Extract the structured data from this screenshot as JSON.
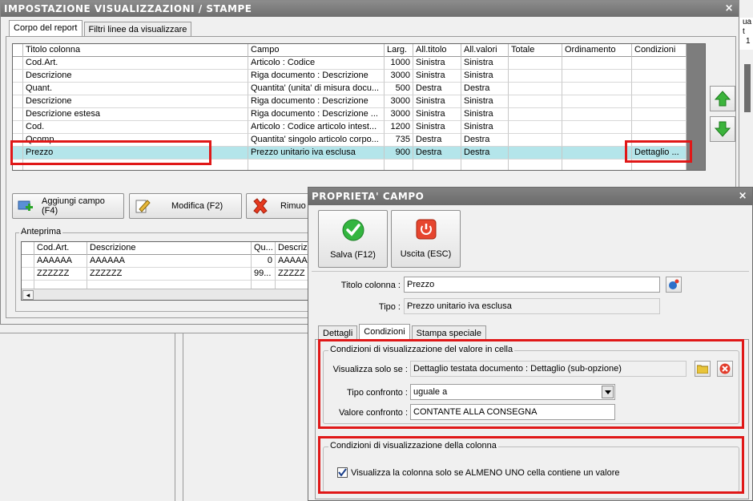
{
  "main": {
    "title": "IMPOSTAZIONE VISUALIZZAZIONI / STAMPE",
    "close_glyph": "×",
    "tabs": [
      "Corpo del report",
      "Filtri linee da visualizzare"
    ],
    "columns": [
      "Titolo colonna",
      "Campo",
      "Larg.",
      "All.titolo",
      "All.valori",
      "Totale",
      "Ordinamento",
      "Condizioni"
    ],
    "rows": [
      {
        "titolo": "Cod.Art.",
        "campo": "Articolo : Codice",
        "larg": "1000",
        "all_titolo": "Sinistra",
        "all_valori": "Sinistra",
        "totale": "",
        "ordinamento": "",
        "condizioni": ""
      },
      {
        "titolo": "Descrizione",
        "campo": "Riga documento : Descrizione",
        "larg": "3000",
        "all_titolo": "Sinistra",
        "all_valori": "Sinistra",
        "totale": "",
        "ordinamento": "",
        "condizioni": ""
      },
      {
        "titolo": "Quant.",
        "campo": "Quantita' (unita' di misura docu...",
        "larg": "500",
        "all_titolo": "Destra",
        "all_valori": "Destra",
        "totale": "",
        "ordinamento": "",
        "condizioni": ""
      },
      {
        "titolo": "Descrizione",
        "campo": "Riga documento : Descrizione",
        "larg": "3000",
        "all_titolo": "Sinistra",
        "all_valori": "Sinistra",
        "totale": "",
        "ordinamento": "",
        "condizioni": ""
      },
      {
        "titolo": "Descrizione estesa",
        "campo": "Riga documento : Descrizione ...",
        "larg": "3000",
        "all_titolo": "Sinistra",
        "all_valori": "Sinistra",
        "totale": "",
        "ordinamento": "",
        "condizioni": ""
      },
      {
        "titolo": "Cod.",
        "campo": "Articolo : Codice articolo intest...",
        "larg": "1200",
        "all_titolo": "Sinistra",
        "all_valori": "Sinistra",
        "totale": "",
        "ordinamento": "",
        "condizioni": ""
      },
      {
        "titolo": "Qcomp",
        "campo": "Quantita' singolo articolo corpo...",
        "larg": "735",
        "all_titolo": "Destra",
        "all_valori": "Destra",
        "totale": "",
        "ordinamento": "",
        "condizioni": ""
      },
      {
        "titolo": "Prezzo",
        "campo": "Prezzo unitario iva esclusa",
        "larg": "900",
        "all_titolo": "Destra",
        "all_valori": "Destra",
        "totale": "",
        "ordinamento": "",
        "condizioni": "Dettaglio ..."
      }
    ],
    "buttons": {
      "add": "Aggiungi campo (F4)",
      "edit": "Modifica (F2)",
      "remove": "Rimuo"
    },
    "preview": {
      "legend": "Anteprima",
      "columns": [
        "Cod.Art.",
        "Descrizione",
        "Qu...",
        "Descriz"
      ],
      "rows": [
        [
          "AAAAAA",
          "AAAAAA",
          "0",
          "AAAAA"
        ],
        [
          "ZZZZZZ",
          "ZZZZZZ",
          "99...",
          "ZZZZZ"
        ]
      ],
      "scroll_left": "◂"
    }
  },
  "bg_window": {
    "fragment_lines": [
      "ua",
      "t",
      "1"
    ]
  },
  "dialog": {
    "title": "PROPRIETA' CAMPO",
    "close_glyph": "×",
    "save_label": "Salva (F12)",
    "exit_label": "Uscita (ESC)",
    "titolo_label": "Titolo colonna :",
    "titolo_value": "Prezzo",
    "tipo_label": "Tipo :",
    "tipo_value": "Prezzo unitario iva esclusa",
    "tabs": [
      "Dettagli",
      "Condizioni",
      "Stampa speciale"
    ],
    "cond_value_legend": "Condizioni di visualizzazione del valore in cella",
    "visualizza_label": "Visualizza solo se :",
    "visualizza_value": "Dettaglio testata documento : Dettaglio (sub-opzione)",
    "tipo_confronto_label": "Tipo confronto :",
    "tipo_confronto_value": "uguale a",
    "valore_confronto_label": "Valore confronto :",
    "valore_confronto_value": "CONTANTE ALLA CONSEGNA",
    "cond_col_legend": "Condizioni di visualizzazione della colonna",
    "checkbox_label": "Visualizza la colonna solo se ALMENO UNO cella contiene un valore",
    "checkbox_checked": true
  },
  "icons": [
    "add-field-icon",
    "edit-icon",
    "remove-icon",
    "arrow-up-icon",
    "arrow-down-icon",
    "checkmark-icon",
    "power-icon",
    "color-picker-icon",
    "folder-icon",
    "clear-icon",
    "dropdown-arrow-icon",
    "checkbox-check-icon"
  ],
  "colors": {
    "selected_row": "#b4e5ea",
    "highlight_border": "#e01818",
    "titlebar": "#7a7a7a",
    "green_arrow": "#2fa52f"
  }
}
